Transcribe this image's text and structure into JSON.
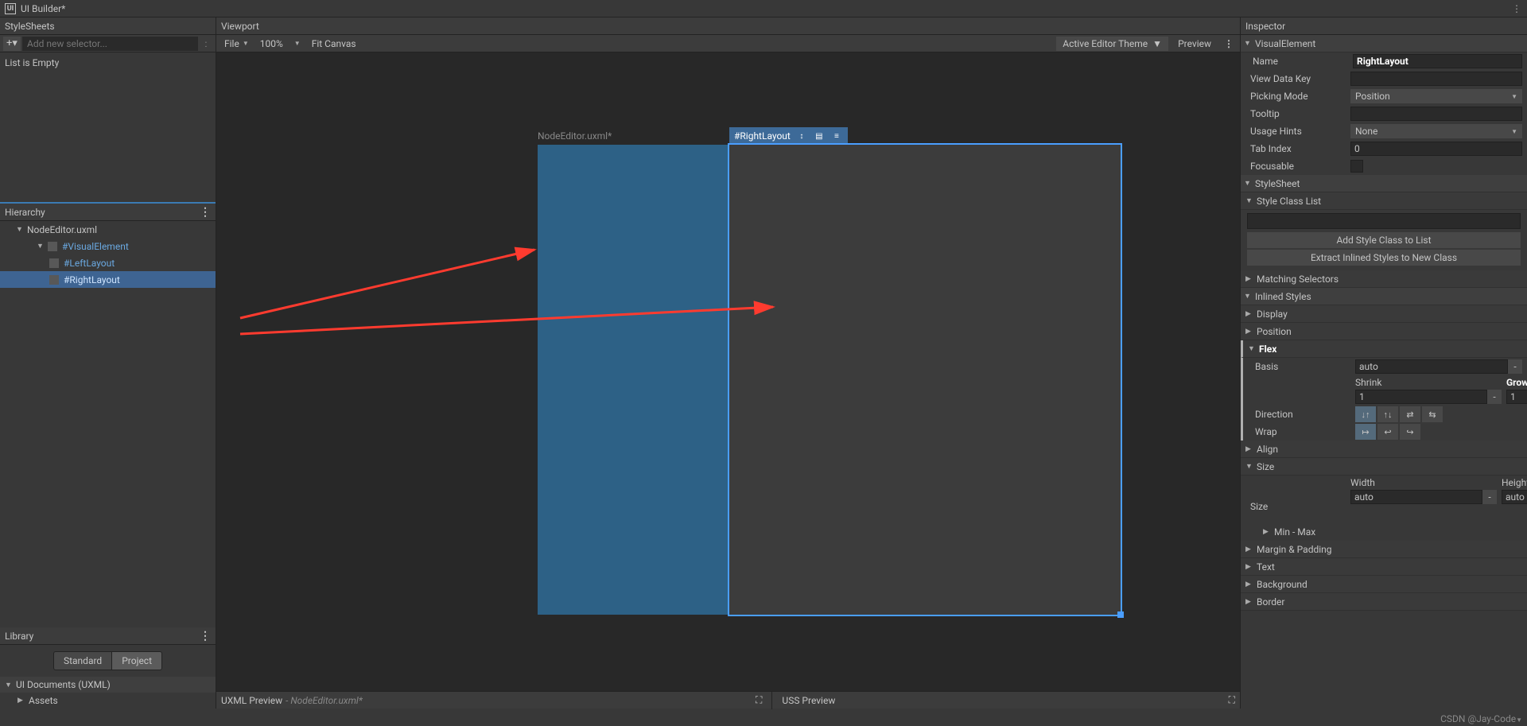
{
  "title": "UI Builder*",
  "stylesheets": {
    "header": "StyleSheets",
    "add_placeholder": "Add new selector...",
    "empty": "List is Empty"
  },
  "hierarchy": {
    "header": "Hierarchy",
    "root": "NodeEditor.uxml",
    "ve": "#VisualElement",
    "left": "#LeftLayout",
    "right": "#RightLayout"
  },
  "library": {
    "header": "Library",
    "tab_standard": "Standard",
    "tab_project": "Project",
    "section": "UI Documents (UXML)",
    "assets": "Assets"
  },
  "viewport": {
    "header": "Viewport",
    "file": "File",
    "zoom": "100%",
    "fit": "Fit Canvas",
    "theme": "Active Editor Theme",
    "preview": "Preview",
    "doc_name": "NodeEditor.uxml*",
    "sel_tag": "#RightLayout"
  },
  "preview": {
    "uxml": "UXML Preview",
    "uxml_sub": "- NodeEditor.uxml*",
    "uss": "USS Preview"
  },
  "inspector": {
    "header": "Inspector",
    "ve_fold": "VisualElement",
    "name_lbl": "Name",
    "name_val": "RightLayout",
    "vdk_lbl": "View Data Key",
    "pm_lbl": "Picking Mode",
    "pm_val": "Position",
    "tooltip_lbl": "Tooltip",
    "uh_lbl": "Usage Hints",
    "uh_val": "None",
    "ti_lbl": "Tab Index",
    "ti_val": "0",
    "foc_lbl": "Focusable",
    "ss_fold": "StyleSheet",
    "scl_fold": "Style Class List",
    "add_class": "Add Style Class to List",
    "extract": "Extract Inlined Styles to New Class",
    "match_sel": "Matching Selectors",
    "inlined": "Inlined Styles",
    "display": "Display",
    "position": "Position",
    "flex": "Flex",
    "basis_lbl": "Basis",
    "basis_val": "auto",
    "shrink_lbl": "Shrink",
    "shrink_val": "1",
    "grow_lbl": "Grow",
    "grow_val": "1",
    "dir_lbl": "Direction",
    "wrap_lbl": "Wrap",
    "align": "Align",
    "size": "Size",
    "size_lbl": "Size",
    "width_lbl": "Width",
    "width_val": "auto",
    "height_lbl": "Height",
    "height_val": "auto",
    "minmax": "Min - Max",
    "margin": "Margin & Padding",
    "text": "Text",
    "background": "Background",
    "border": "Border"
  },
  "watermark": "CSDN @Jay-Code"
}
